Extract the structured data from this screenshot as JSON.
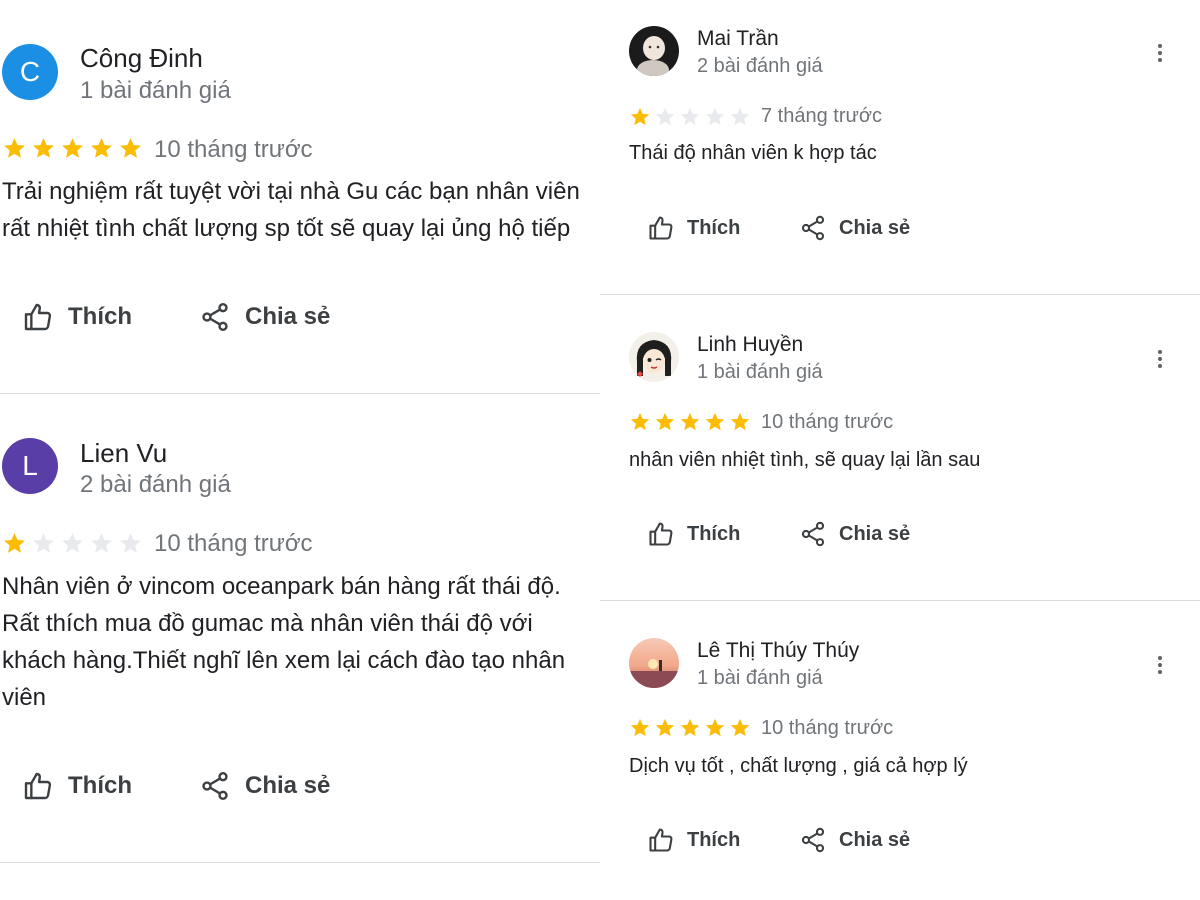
{
  "actions": {
    "like_label": "Thích",
    "share_label": "Chia sẻ"
  },
  "colors": {
    "star_filled": "#fbbc04",
    "star_empty": "#e8eaed",
    "avatar_c": "#1a8fe3",
    "avatar_l": "#5a3ea8"
  },
  "left": {
    "reviews": [
      {
        "name": "Công Đinh",
        "count": "1 bài đánh giá",
        "avatar_letter": "C",
        "rating": 5,
        "time": "10 tháng trước",
        "lines": [
          "Trải nghiệm rất tuyệt vời tại nhà Gu các bạn nhân viên",
          "rất nhiệt tình chất lượng sp tốt sẽ quay lại ủng hộ tiếp"
        ]
      },
      {
        "name": "Lien Vu",
        "count": "2 bài đánh giá",
        "avatar_letter": "L",
        "rating": 1,
        "time": "10 tháng trước",
        "lines": [
          "Nhân viên ở vincom oceanpark bán hàng rất thái độ.",
          "Rất thích mua đồ gumac mà nhân viên thái độ với",
          "khách hàng.Thiết nghĩ lên xem lại cách đào tạo nhân",
          "viên"
        ]
      }
    ]
  },
  "right": {
    "reviews": [
      {
        "name": "Mai Trần",
        "count": "2 bài đánh giá",
        "rating": 1,
        "time": "7 tháng trước",
        "text": "Thái độ nhân viên k hợp tác",
        "avatar_icon": "baby-photo-avatar"
      },
      {
        "name": "Linh Huyền",
        "count": "1 bài đánh giá",
        "rating": 5,
        "time": "10 tháng trước",
        "text": "nhân viên nhiệt tình, sẽ quay lại lần sau",
        "avatar_icon": "cartoon-girl-avatar"
      },
      {
        "name": "Lê Thị Thúy Thúy",
        "count": "1 bài đánh giá",
        "rating": 5,
        "time": "10 tháng trước",
        "text": "Dịch vụ tốt , chất lượng , giá cả hợp lý",
        "avatar_icon": "sunset-photo-avatar"
      }
    ]
  }
}
